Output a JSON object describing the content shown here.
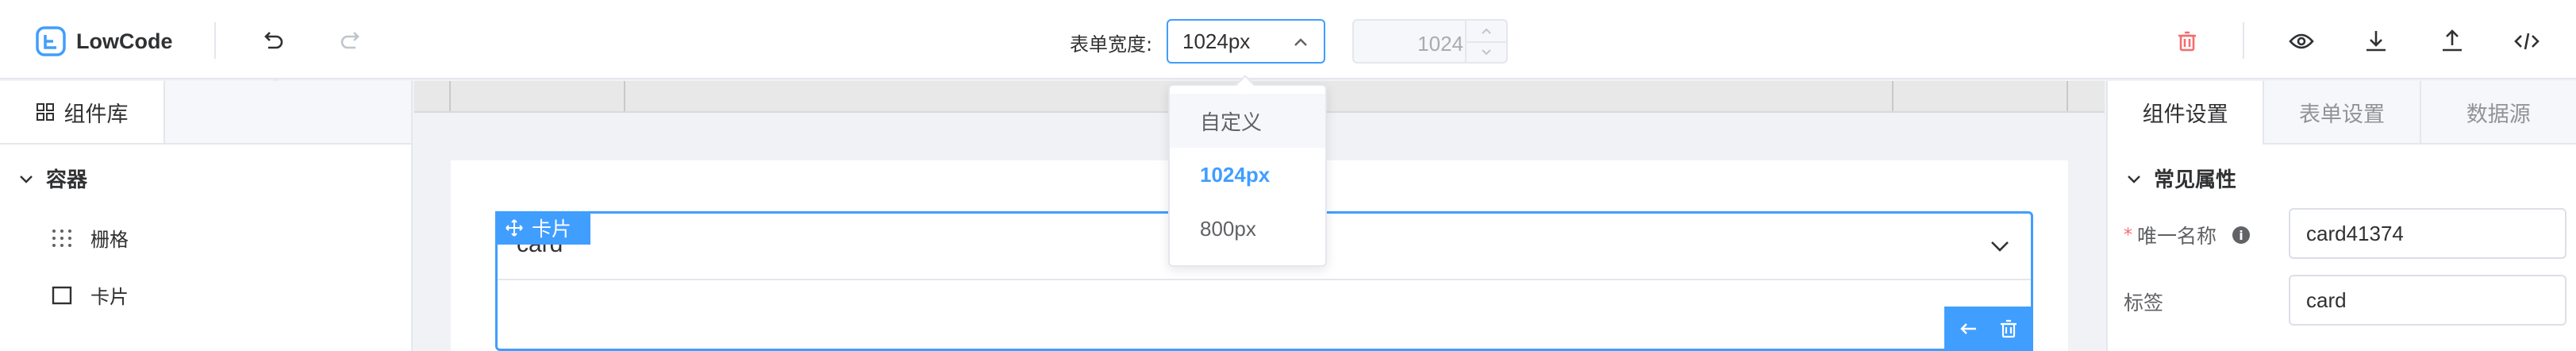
{
  "app": {
    "logo_text": "LowCode"
  },
  "toolbar": {
    "undo_tooltip": "撤销",
    "form_width_label": "表单宽度:",
    "form_width_value": "1024px",
    "custom_width_value": "1024",
    "width_options": [
      "自定义",
      "1024px",
      "800px"
    ]
  },
  "colors": {
    "accent": "#409eff",
    "danger": "#f56c6c"
  },
  "left_panel": {
    "tab_label": "组件库",
    "group_label": "容器",
    "items": [
      {
        "label": "栅格",
        "icon": "grid-dots-icon"
      },
      {
        "label": "卡片",
        "icon": "card-square-icon"
      }
    ]
  },
  "canvas": {
    "card_tag_label": "卡片",
    "card_title": "card"
  },
  "right_panel": {
    "tabs": [
      "组件设置",
      "表单设置",
      "数据源"
    ],
    "group_label": "常见属性",
    "fields": [
      {
        "label": "唯一名称",
        "value": "card41374",
        "required_mark": "*",
        "info": "i"
      },
      {
        "label": "标签",
        "value": "card"
      }
    ]
  }
}
